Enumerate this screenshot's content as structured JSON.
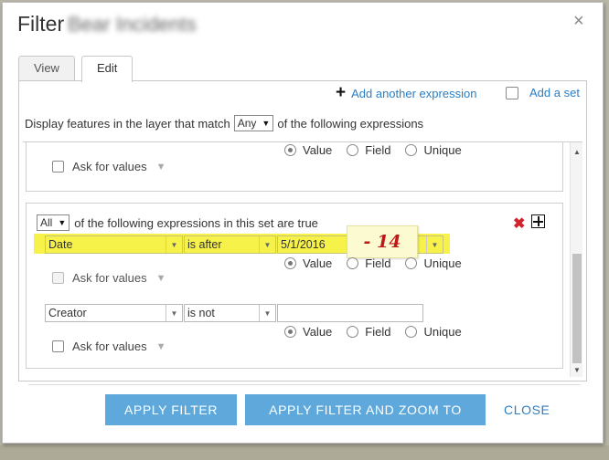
{
  "dialog": {
    "title": "Filter",
    "title_suffix": "Bear Incidents",
    "close_glyph": "×"
  },
  "tabs": [
    {
      "label": "View",
      "active": false
    },
    {
      "label": "Edit",
      "active": true
    }
  ],
  "toolbar": {
    "add_expression_label": "Add another expression",
    "add_set_label": "Add a set"
  },
  "match": {
    "prefix": "Display features in the layer that match",
    "selected": "Any",
    "suffix": "of the following expressions"
  },
  "set1": {
    "value_options": [
      "Value",
      "Field",
      "Unique"
    ],
    "selected_option": "Value",
    "ask_label": "Ask for values"
  },
  "set2": {
    "match_selected": "All",
    "header_suffix": "of the following expressions in this set are true",
    "expr1": {
      "field": "Date",
      "operator": "is after",
      "value": "5/1/2016",
      "value_options": [
        "Value",
        "Field",
        "Unique"
      ],
      "selected_option": "Value",
      "ask_label": "Ask for values",
      "annotation": "- 14"
    },
    "expr2": {
      "field": "Creator",
      "operator": "is not",
      "value": "",
      "value_options": [
        "Value",
        "Field",
        "Unique"
      ],
      "selected_option": "Value",
      "ask_label": "Ask for values"
    }
  },
  "buttons": {
    "apply": "APPLY FILTER",
    "apply_zoom": "APPLY FILTER AND ZOOM TO",
    "close": "CLOSE"
  },
  "colors": {
    "accent": "#5fa8db",
    "link": "#2b7ec4",
    "highlight": "#f6f24a",
    "remove": "#d0232b",
    "annotation": "#c01818"
  }
}
